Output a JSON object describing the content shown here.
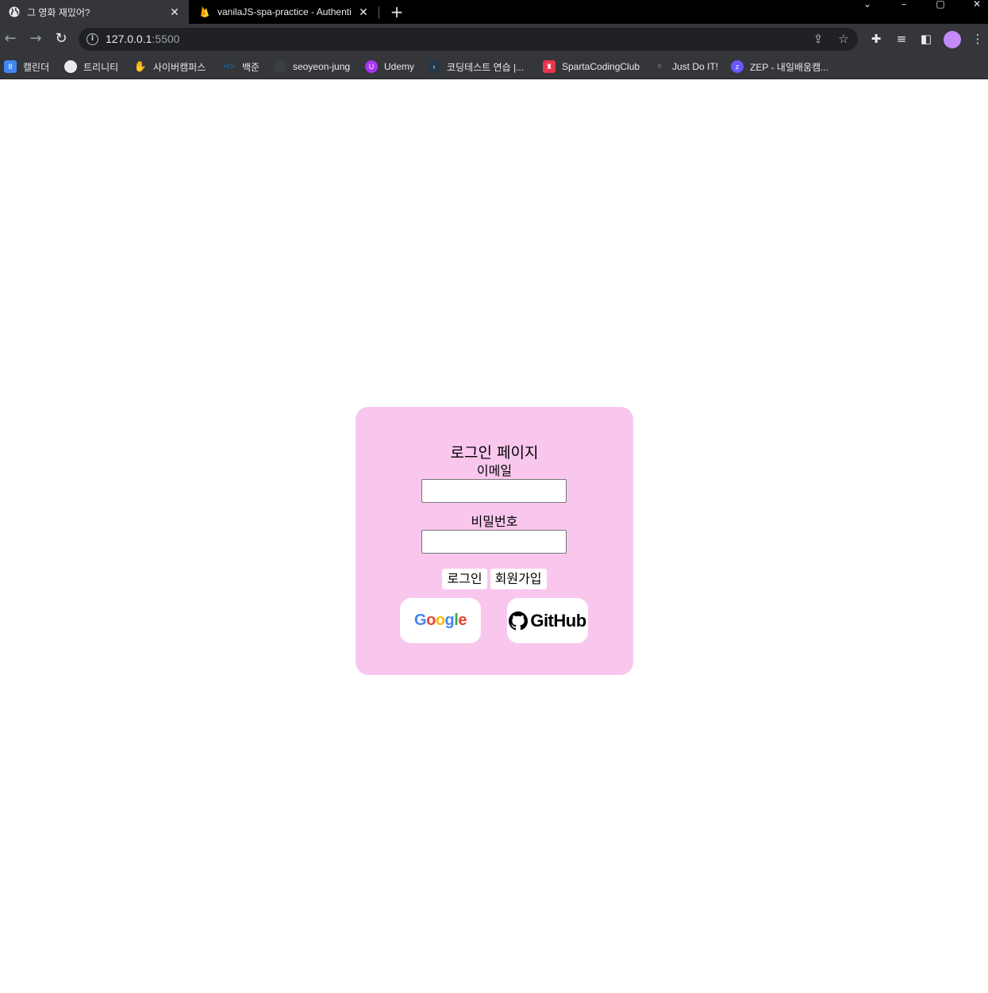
{
  "browser": {
    "tabs": [
      {
        "title": "그 영화 재밌어?",
        "active": true
      },
      {
        "title": "vanilaJS-spa-practice - Authenti",
        "active": false
      }
    ],
    "new_tab_glyph": "+",
    "close_glyph": "✕",
    "url_host": "127.0.0.1",
    "url_port": ":5500",
    "bookmarks": [
      {
        "label": "캘린더",
        "icon": "calendar-icon",
        "color": "#4285f4"
      },
      {
        "label": "트리니티",
        "icon": "globe-icon",
        "color": "#5f6368"
      },
      {
        "label": "사이버캠퍼스",
        "icon": "hand-icon",
        "color": "#34a853"
      },
      {
        "label": "백준",
        "icon": "baekjoon-icon",
        "color": "#0076c0"
      },
      {
        "label": "seoyeon-jung",
        "icon": "github-icon",
        "color": "#3c4043"
      },
      {
        "label": "Udemy",
        "icon": "udemy-icon",
        "color": "#a435f0"
      },
      {
        "label": "코딩테스트 연습 |...",
        "icon": "programmers-icon",
        "color": "#263747"
      },
      {
        "label": "SpartaCodingClub",
        "icon": "sparta-icon",
        "color": "#e8344e"
      },
      {
        "label": "Just Do IT!",
        "icon": "dots-icon",
        "color": "#202124"
      },
      {
        "label": "ZEP - 내일배움캠...",
        "icon": "zep-icon",
        "color": "#6758ff"
      }
    ]
  },
  "login": {
    "title": "로그인 페이지",
    "email_label": "이메일",
    "email_value": "",
    "password_label": "비밀번호",
    "password_value": "",
    "login_button": "로그인",
    "signup_button": "회원가입",
    "google_logo_letters": [
      "G",
      "o",
      "o",
      "g",
      "l",
      "e"
    ],
    "google_colors": [
      "#4285f4",
      "#ea4335",
      "#fbbc05",
      "#4285f4",
      "#34a853",
      "#ea4335"
    ],
    "github_logo_text": "GitHub"
  },
  "colors": {
    "card_background": "#f9c7ee",
    "chrome_dark": "#35363a"
  }
}
